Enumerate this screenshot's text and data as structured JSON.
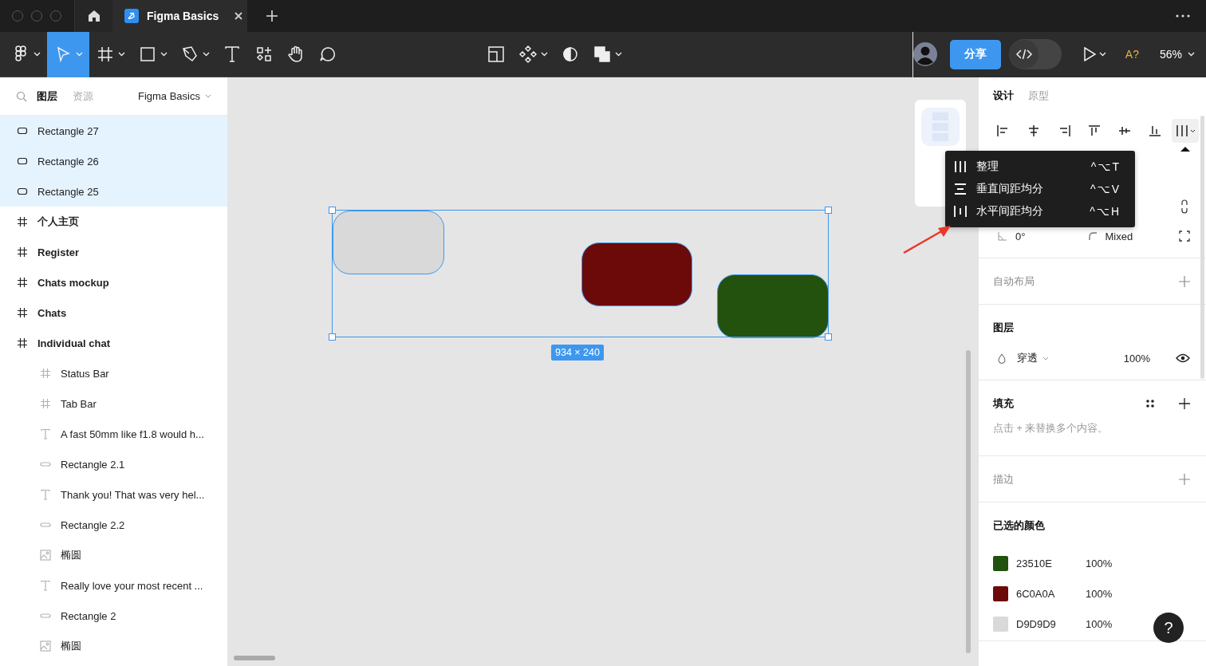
{
  "browser_tabs": [
    {
      "title": "Figma Basics",
      "selected": true
    }
  ],
  "toolbar": {
    "tools": [
      {
        "kind": "main-menu",
        "menu": true,
        "selected": false
      },
      {
        "kind": "move",
        "menu": true,
        "selected": true
      },
      {
        "kind": "frame",
        "menu": true,
        "selected": false
      },
      {
        "kind": "rectangle",
        "menu": true,
        "selected": false
      },
      {
        "kind": "pen",
        "menu": true,
        "selected": false
      },
      {
        "kind": "text",
        "menu": false,
        "selected": false
      },
      {
        "kind": "resources",
        "menu": false,
        "selected": false
      },
      {
        "kind": "hand",
        "menu": false,
        "selected": false
      },
      {
        "kind": "comment",
        "menu": false,
        "selected": false
      }
    ],
    "center_tools": [
      {
        "kind": "crop",
        "menu": false,
        "selected": false
      },
      {
        "kind": "component",
        "menu": true,
        "selected": false
      },
      {
        "kind": "mask",
        "menu": false,
        "selected": false
      },
      {
        "kind": "boolean",
        "menu": true,
        "selected": false
      }
    ],
    "share_button": "分享",
    "dev_mode": {
      "on": false
    },
    "font_check": "A?",
    "zoom": "56%"
  },
  "layers": {
    "tabs": [
      {
        "label": "图层",
        "selected": true
      },
      {
        "label": "资源",
        "selected": false
      }
    ],
    "page": "Figma Basics",
    "items": [
      {
        "kind": "rectangle",
        "name": "Rectangle 27",
        "selected": true
      },
      {
        "kind": "rectangle",
        "name": "Rectangle 26",
        "selected": true
      },
      {
        "kind": "rectangle",
        "name": "Rectangle 25",
        "selected": true
      },
      {
        "kind": "frame",
        "name": "个人主页",
        "selected": false
      },
      {
        "kind": "frame",
        "name": "Register",
        "selected": false
      },
      {
        "kind": "frame",
        "name": "Chats mockup",
        "selected": false
      },
      {
        "kind": "frame",
        "name": "Chats",
        "selected": false
      },
      {
        "kind": "frame",
        "name": "Individual chat",
        "selected": false,
        "children": [
          {
            "kind": "frame",
            "name": "Status Bar",
            "selected": false
          },
          {
            "kind": "frame",
            "name": "Tab Bar",
            "selected": false
          },
          {
            "kind": "text",
            "name": "A fast 50mm like f1.8 would h...",
            "selected": false
          },
          {
            "kind": "rectangle",
            "name": "Rectangle 2.1",
            "selected": false
          },
          {
            "kind": "text",
            "name": "Thank you! That was very hel...",
            "selected": false
          },
          {
            "kind": "rectangle",
            "name": "Rectangle 2.2",
            "selected": false
          },
          {
            "kind": "image",
            "name": "椭圆",
            "selected": false
          },
          {
            "kind": "text",
            "name": "Really love your most recent ...",
            "selected": false
          },
          {
            "kind": "rectangle",
            "name": "Rectangle 2",
            "selected": false
          },
          {
            "kind": "image",
            "name": "椭圆",
            "selected": false
          }
        ]
      }
    ]
  },
  "canvas": {
    "shapes": [
      {
        "color": "#d9d9d9"
      },
      {
        "color": "#6c0a0a"
      },
      {
        "color": "#23510e"
      }
    ],
    "selection_size": "934 × 240"
  },
  "menu": {
    "items": [
      {
        "kind": "tidy",
        "label": "整理",
        "shortcut": "^⌥T"
      },
      {
        "kind": "vertical",
        "label": "垂直间距均分",
        "shortcut": "^⌥V"
      },
      {
        "kind": "horizontal",
        "label": "水平间距均分",
        "shortcut": "^⌥H"
      }
    ]
  },
  "design": {
    "tabs": [
      {
        "label": "设计",
        "selected": true
      },
      {
        "label": "原型",
        "selected": false
      }
    ],
    "align_tools": [
      {
        "kind": "align-left",
        "selected": false
      },
      {
        "kind": "align-center",
        "selected": false
      },
      {
        "kind": "align-right",
        "selected": false
      },
      {
        "kind": "align-top",
        "selected": false
      },
      {
        "kind": "align-middle",
        "selected": false
      },
      {
        "kind": "align-bottom",
        "selected": false
      },
      {
        "kind": "distribute",
        "selected": true
      }
    ],
    "rotation": "0°",
    "corner_radius": "Mixed",
    "auto_layout": {
      "title": "自动布局",
      "muted": true
    },
    "layer": {
      "title": "图层",
      "muted": false,
      "blend_mode": "穿透",
      "opacity": "100%",
      "visible": true
    },
    "fill": {
      "title": "填充",
      "muted": false,
      "hint": "点击 + 来替换多个内容。"
    },
    "stroke": {
      "title": "描边",
      "muted": true
    },
    "selected_colors": {
      "title": "已选的颜色",
      "muted": false,
      "items": [
        {
          "hex": "23510E",
          "opacity": "100%",
          "color": "#23510e"
        },
        {
          "hex": "6C0A0A",
          "opacity": "100%",
          "color": "#6c0a0a"
        },
        {
          "hex": "D9D9D9",
          "opacity": "100%",
          "color": "#d9d9d9"
        }
      ]
    }
  },
  "help_button": "?"
}
